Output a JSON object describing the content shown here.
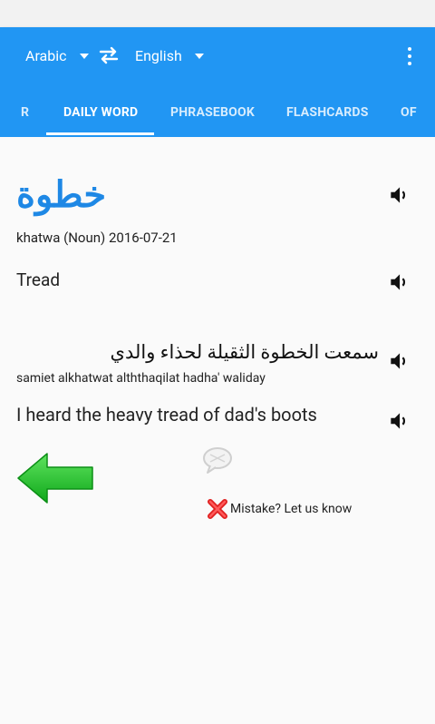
{
  "header": {
    "source_language": "Arabic",
    "target_language": "English",
    "tabs": [
      {
        "label": "R",
        "active": false
      },
      {
        "label": "DAILY WORD",
        "active": true
      },
      {
        "label": "PHRASEBOOK",
        "active": false
      },
      {
        "label": "FLASHCARDS",
        "active": false
      },
      {
        "label": "OF",
        "active": false
      }
    ],
    "color": "#2196f3"
  },
  "daily_word": {
    "arabic": "خطوة",
    "transliteration_info": "khatwa (Noun) 2016-07-21",
    "translation": "Tread",
    "example_arabic": "سمعت الخطوة الثقيلة لحذاء والدي",
    "example_transliteration": "samiet alkhatwat alththaqilat hadha' waliday",
    "example_english": "I heard the heavy tread of dad's boots",
    "accent_color": "#1e88e5"
  },
  "feedback": {
    "mistake_label": "Mistake? Let us know"
  },
  "icons": [
    "swap-icon",
    "more-vert-icon",
    "speaker-icon",
    "back-arrow-icon",
    "comment-icon",
    "close-x-icon",
    "dropdown-caret-icon"
  ]
}
